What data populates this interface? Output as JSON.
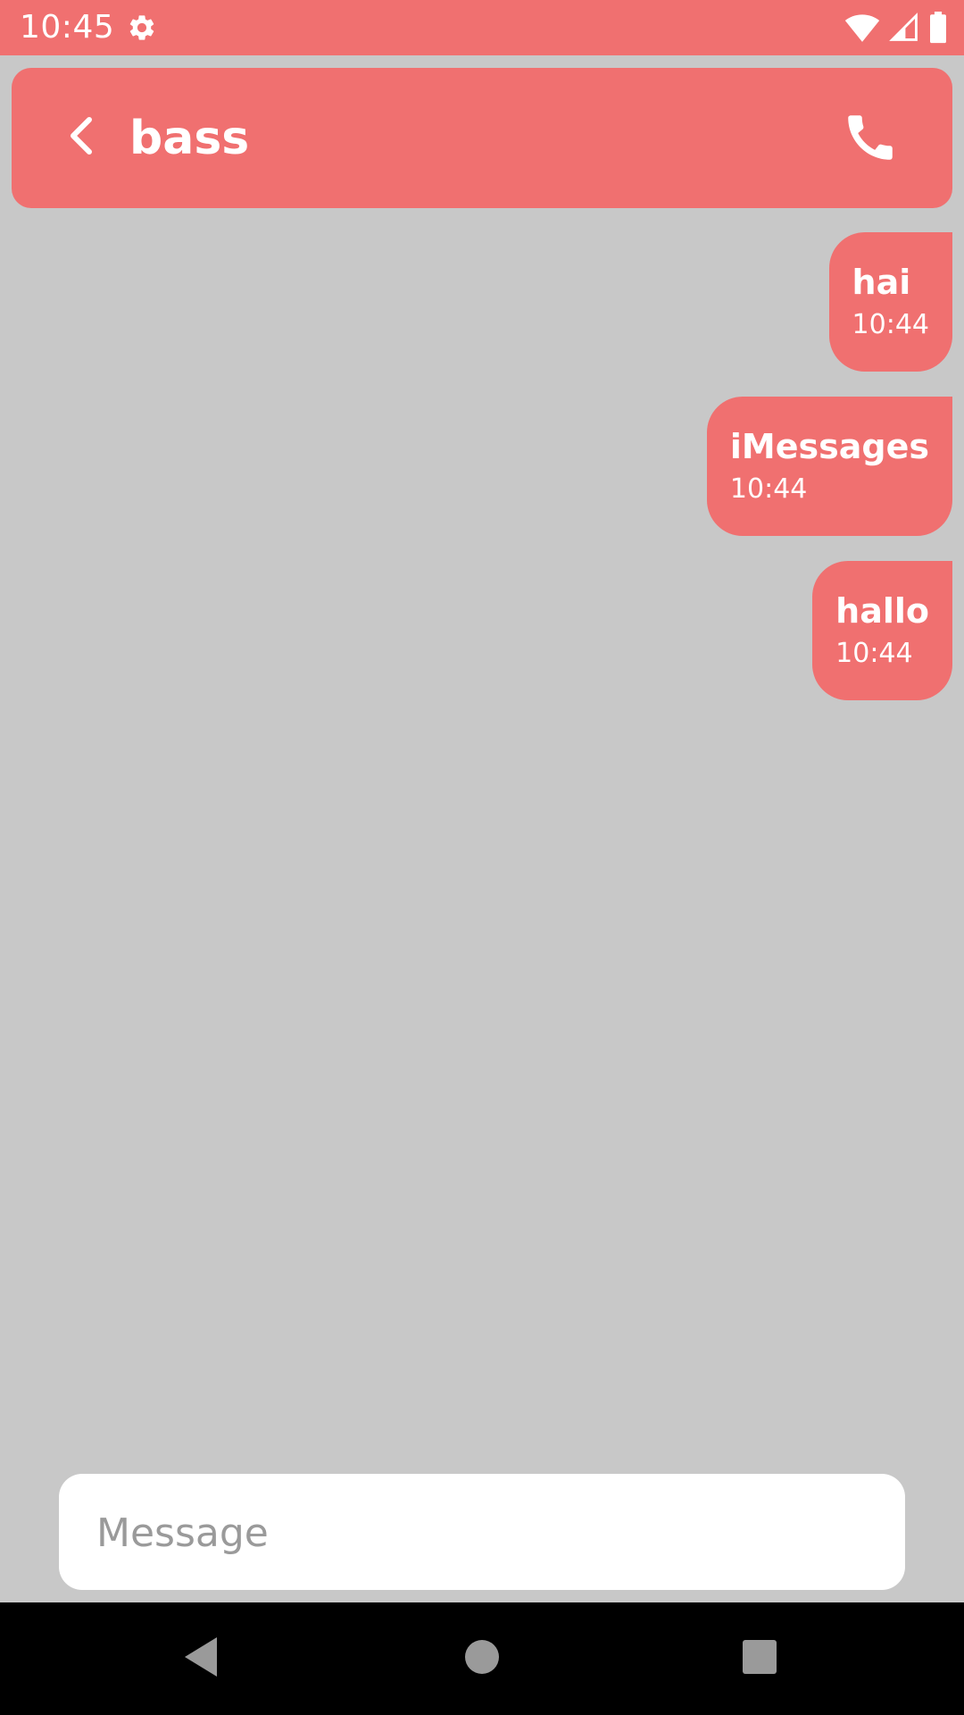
{
  "status_bar": {
    "time": "10:45",
    "icons": [
      "settings-gear-icon",
      "wifi-icon",
      "cell-signal-icon",
      "battery-icon"
    ]
  },
  "header": {
    "contact_name": "bass",
    "back_icon": "chevron-left-icon",
    "call_icon": "phone-icon"
  },
  "messages": [
    {
      "text": "hai",
      "time": "10:44"
    },
    {
      "text": "iMessages",
      "time": "10:44"
    },
    {
      "text": "hallo",
      "time": "10:44"
    }
  ],
  "composer": {
    "placeholder": "Message",
    "value": ""
  },
  "nav_bar": {
    "icons": [
      "back-triangle-icon",
      "home-circle-icon",
      "recents-square-icon"
    ]
  },
  "colors": {
    "accent": "#f07070",
    "background": "#c8c8c8",
    "bubble_text": "#ffffff",
    "nav_bar": "#000000",
    "nav_icon": "#9a9a9a"
  }
}
